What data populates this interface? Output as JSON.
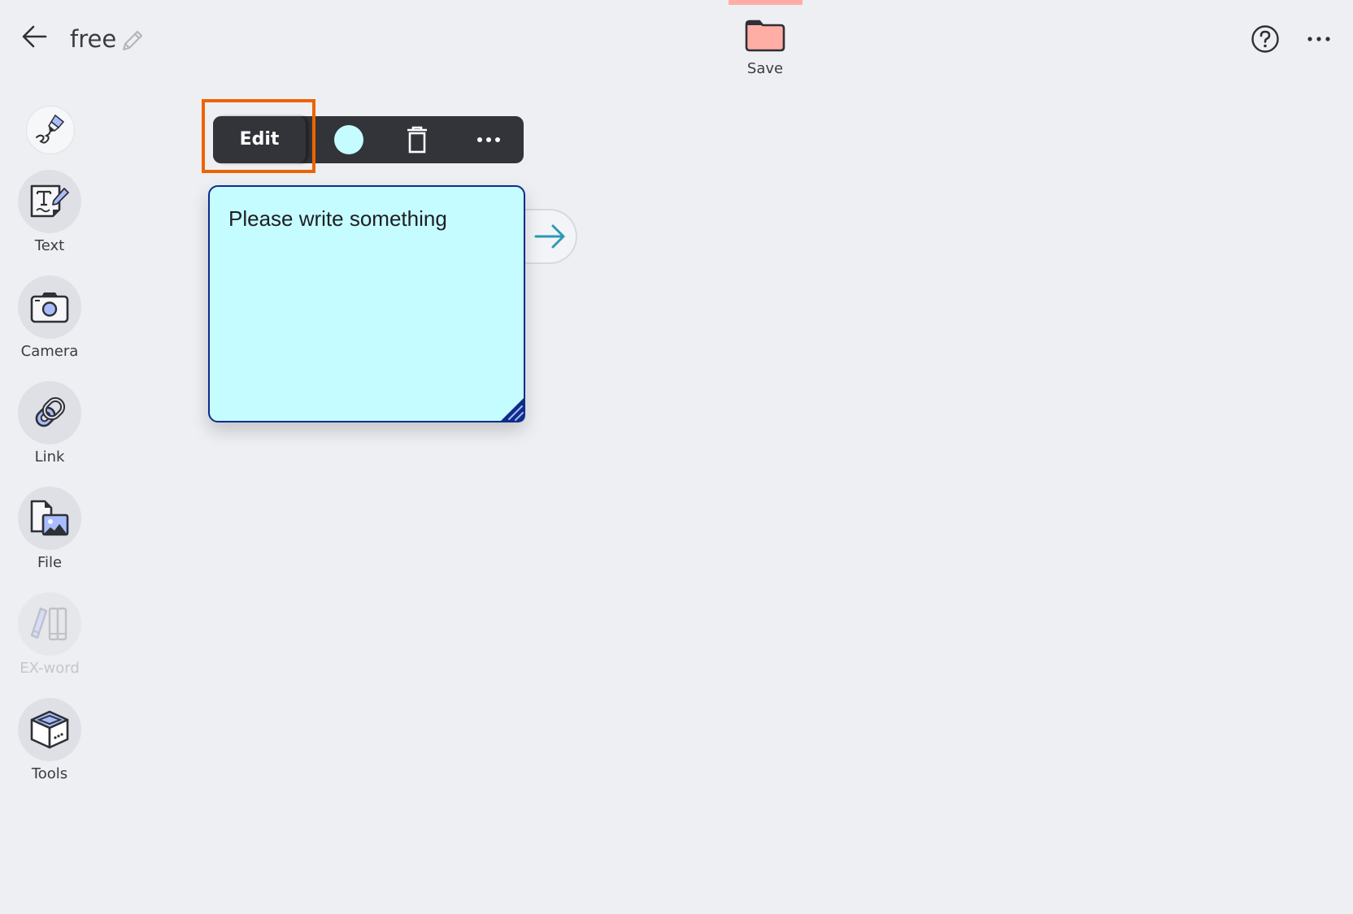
{
  "header": {
    "back_icon": "arrow-left-icon",
    "title": "free",
    "rename_icon": "pencil-icon",
    "save": {
      "label": "Save",
      "icon": "folder-icon",
      "status_color": "#ffaea5"
    },
    "help_icon": "question-circle-icon",
    "more_icon": "ellipsis-icon"
  },
  "sidebar": {
    "pen": {
      "icon": "pen-icon"
    },
    "items": [
      {
        "label": "Text",
        "icon": "text-card-icon",
        "enabled": true
      },
      {
        "label": "Camera",
        "icon": "camera-icon",
        "enabled": true
      },
      {
        "label": "Link",
        "icon": "link-icon",
        "enabled": true
      },
      {
        "label": "File",
        "icon": "file-image-icon",
        "enabled": true
      },
      {
        "label": "EX-word",
        "icon": "books-icon",
        "enabled": false
      },
      {
        "label": "Tools",
        "icon": "toolbox-icon",
        "enabled": true
      }
    ]
  },
  "card_toolbar": {
    "edit_label": "Edit",
    "color": "#c5fcff",
    "delete_icon": "trash-icon",
    "more_icon": "ellipsis-icon",
    "highlight_color": "#ec6400"
  },
  "note": {
    "text": "Please write something",
    "background": "#c5fcff",
    "border": "#0e2c8a",
    "next_icon": "arrow-right-icon"
  }
}
